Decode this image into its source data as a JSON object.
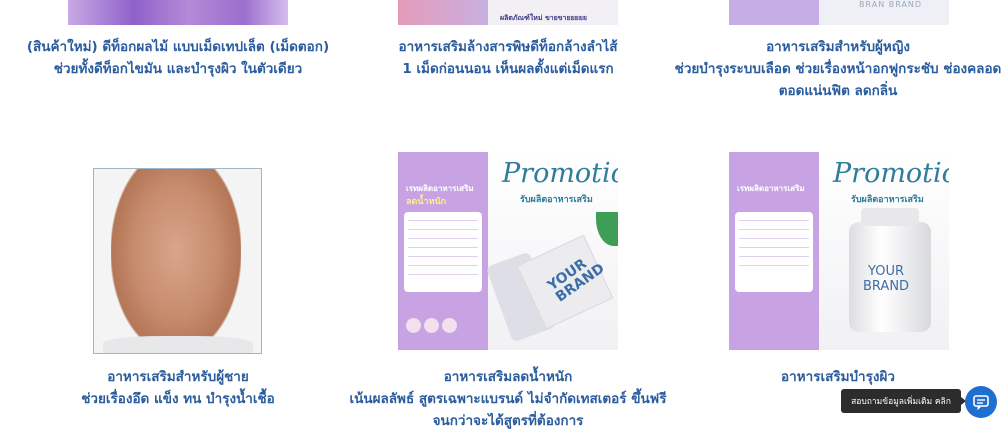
{
  "products": [
    {
      "id_label": "purple-pills",
      "caption_lines": [
        "(สินค้าใหม่) ดีท็อกผลไม้ แบบเม็ดเทปเล็ต (เม็ดตอก)",
        "ช่วยทั้งดีท็อกไขมัน และบำรุงผิว ในตัวเดียว"
      ]
    },
    {
      "id_label": "detox-capsule",
      "image_text": "ผลิตภัณฑ์ใหม่ ขายขายยยยย",
      "caption_lines": [
        "อาหารเสริมล้างสารพิษดีท็อกล้างลำไส้",
        "1 เม็ดก่อนนอน เห็นผลตั้งแต่เม็ดแรก"
      ]
    },
    {
      "id_label": "women-supplement",
      "image_text": "BRAN  BRAND",
      "caption_lines": [
        "อาหารเสริมสำหรับผู้หญิง",
        "ช่วยบำรุงระบบเลือด ช่วยเรื่องหน้าอกฟูกระชับ ช่องคลอด",
        "ตอดแน่นฟิต ลดกลิ่น"
      ]
    },
    {
      "id_label": "men-supplement",
      "caption_lines": [
        "อาหารเสริมสำหรับผู้ชาย",
        "ช่วยเรื่องอึด แข็ง ทน บำรุงน้ำเชื้อ"
      ]
    },
    {
      "id_label": "weight-loss",
      "image": {
        "promo_title": "Promotion",
        "promo_sub": "รับผลิตอาหารเสริม",
        "left_title": "เรทผลิตอาหารเสริม",
        "left_sub": "ลดน้ำหนัก",
        "brand": "YOUR BRAND"
      },
      "caption_lines": [
        "อาหารเสริมลดน้ำหนัก",
        "เน้นผลลัพธ์ สูตรเฉพาะแบรนด์ ไม่จำกัดเทสเตอร์ ขึ้นฟรี",
        "จนกว่าจะได้สูตรที่ต้องการ"
      ]
    },
    {
      "id_label": "skin-supplement",
      "image": {
        "promo_title": "Promotion",
        "promo_sub": "รับผลิตอาหารเสริม",
        "left_title": "เรทผลิตอาหารเสริม",
        "brand_line1": "YOUR",
        "brand_line2": "BRAND"
      },
      "caption_lines": [
        "อาหารเสริมบำรุงผิว"
      ]
    }
  ],
  "chat": {
    "tooltip": "สอบถามข้อมูลเพิ่มเติม คลิก",
    "icon": "chat-bubble-icon"
  }
}
